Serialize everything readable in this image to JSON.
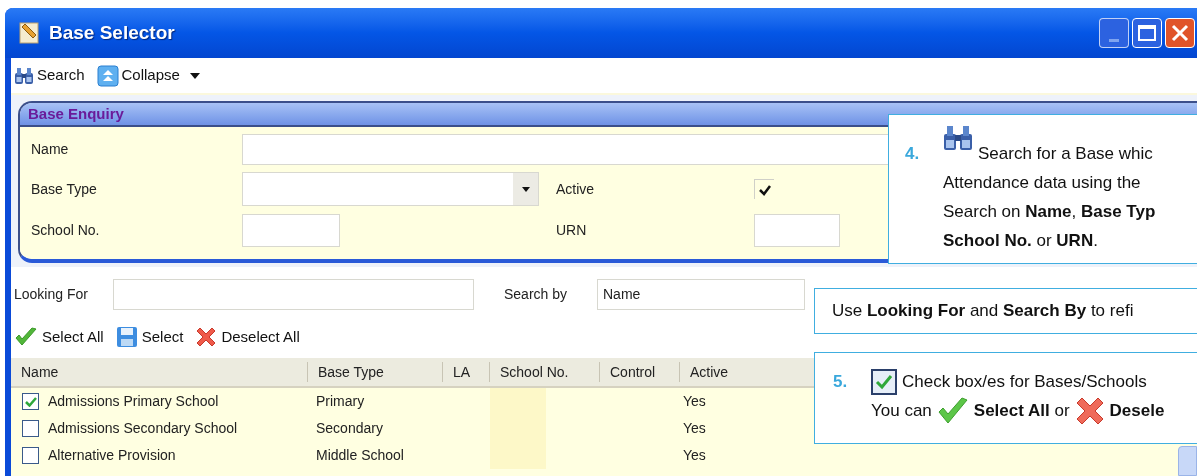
{
  "window": {
    "title": "Base Selector"
  },
  "toolbar": [
    {
      "label": "Search",
      "kind": "search"
    },
    {
      "label": "Collapse",
      "kind": "collapse"
    }
  ],
  "enquiry": {
    "title": "Base Enquiry",
    "name_label": "Name",
    "base_type_label": "Base Type",
    "active_label": "Active",
    "active_checked": true,
    "school_no_label": "School No.",
    "urn_label": "URN"
  },
  "search": {
    "looking_for_label": "Looking For",
    "search_by_label": "Search by",
    "search_by_value": "Name"
  },
  "actions": [
    {
      "label": "Select All",
      "kind": "tick"
    },
    {
      "label": "Select",
      "kind": "save"
    },
    {
      "label": "Deselect All",
      "kind": "cross"
    }
  ],
  "table": {
    "columns": [
      "Name",
      "Base Type",
      "LA",
      "School No.",
      "Control",
      "Active"
    ],
    "rows": [
      {
        "checked": true,
        "name": "Admissions Primary School",
        "base_type": "Primary",
        "active": "Yes"
      },
      {
        "checked": false,
        "name": "Admissions Secondary School",
        "base_type": "Secondary",
        "active": "Yes"
      },
      {
        "checked": false,
        "name": "Alternative Provision",
        "base_type": "Middle School",
        "active": "Yes"
      }
    ]
  },
  "callouts": [
    {
      "number": "4.",
      "lines": [
        [
          {
            "kind": "binoculars"
          },
          {
            "kind": "text",
            "text": "Search for a Base whic"
          }
        ],
        [
          {
            "kind": "text",
            "text": "Attendance data using the"
          }
        ],
        [
          {
            "kind": "text",
            "text": "Search on **Name**, **Base Typ**"
          }
        ],
        [
          {
            "kind": "text",
            "text": "**School No.** or **URN**."
          }
        ]
      ]
    },
    {
      "lines": [
        [
          {
            "kind": "text",
            "text": "Use **Looking For** and **Search By** to refi"
          }
        ]
      ]
    },
    {
      "number": "5.",
      "lines": [
        [
          {
            "kind": "checkbox"
          },
          {
            "kind": "text",
            "text": "Check box/es for Bases/Schools"
          }
        ],
        [
          {
            "kind": "text",
            "text": "You can"
          },
          {
            "kind": "tick"
          },
          {
            "kind": "text",
            "text": "**Select All** or"
          },
          {
            "kind": "cross"
          },
          {
            "kind": "text",
            "text": "**Desele**"
          }
        ]
      ]
    }
  ]
}
